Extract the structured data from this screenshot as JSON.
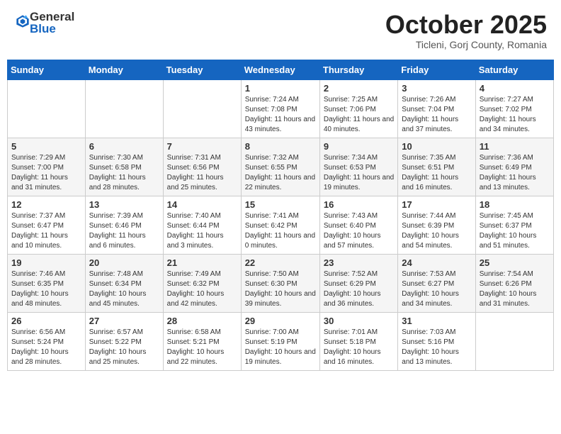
{
  "header": {
    "logo_general": "General",
    "logo_blue": "Blue",
    "month": "October 2025",
    "location": "Ticleni, Gorj County, Romania"
  },
  "days_of_week": [
    "Sunday",
    "Monday",
    "Tuesday",
    "Wednesday",
    "Thursday",
    "Friday",
    "Saturday"
  ],
  "weeks": [
    [
      {
        "num": "",
        "sunrise": "",
        "sunset": "",
        "daylight": ""
      },
      {
        "num": "",
        "sunrise": "",
        "sunset": "",
        "daylight": ""
      },
      {
        "num": "",
        "sunrise": "",
        "sunset": "",
        "daylight": ""
      },
      {
        "num": "1",
        "sunrise": "Sunrise: 7:24 AM",
        "sunset": "Sunset: 7:08 PM",
        "daylight": "Daylight: 11 hours and 43 minutes."
      },
      {
        "num": "2",
        "sunrise": "Sunrise: 7:25 AM",
        "sunset": "Sunset: 7:06 PM",
        "daylight": "Daylight: 11 hours and 40 minutes."
      },
      {
        "num": "3",
        "sunrise": "Sunrise: 7:26 AM",
        "sunset": "Sunset: 7:04 PM",
        "daylight": "Daylight: 11 hours and 37 minutes."
      },
      {
        "num": "4",
        "sunrise": "Sunrise: 7:27 AM",
        "sunset": "Sunset: 7:02 PM",
        "daylight": "Daylight: 11 hours and 34 minutes."
      }
    ],
    [
      {
        "num": "5",
        "sunrise": "Sunrise: 7:29 AM",
        "sunset": "Sunset: 7:00 PM",
        "daylight": "Daylight: 11 hours and 31 minutes."
      },
      {
        "num": "6",
        "sunrise": "Sunrise: 7:30 AM",
        "sunset": "Sunset: 6:58 PM",
        "daylight": "Daylight: 11 hours and 28 minutes."
      },
      {
        "num": "7",
        "sunrise": "Sunrise: 7:31 AM",
        "sunset": "Sunset: 6:56 PM",
        "daylight": "Daylight: 11 hours and 25 minutes."
      },
      {
        "num": "8",
        "sunrise": "Sunrise: 7:32 AM",
        "sunset": "Sunset: 6:55 PM",
        "daylight": "Daylight: 11 hours and 22 minutes."
      },
      {
        "num": "9",
        "sunrise": "Sunrise: 7:34 AM",
        "sunset": "Sunset: 6:53 PM",
        "daylight": "Daylight: 11 hours and 19 minutes."
      },
      {
        "num": "10",
        "sunrise": "Sunrise: 7:35 AM",
        "sunset": "Sunset: 6:51 PM",
        "daylight": "Daylight: 11 hours and 16 minutes."
      },
      {
        "num": "11",
        "sunrise": "Sunrise: 7:36 AM",
        "sunset": "Sunset: 6:49 PM",
        "daylight": "Daylight: 11 hours and 13 minutes."
      }
    ],
    [
      {
        "num": "12",
        "sunrise": "Sunrise: 7:37 AM",
        "sunset": "Sunset: 6:47 PM",
        "daylight": "Daylight: 11 hours and 10 minutes."
      },
      {
        "num": "13",
        "sunrise": "Sunrise: 7:39 AM",
        "sunset": "Sunset: 6:46 PM",
        "daylight": "Daylight: 11 hours and 6 minutes."
      },
      {
        "num": "14",
        "sunrise": "Sunrise: 7:40 AM",
        "sunset": "Sunset: 6:44 PM",
        "daylight": "Daylight: 11 hours and 3 minutes."
      },
      {
        "num": "15",
        "sunrise": "Sunrise: 7:41 AM",
        "sunset": "Sunset: 6:42 PM",
        "daylight": "Daylight: 11 hours and 0 minutes."
      },
      {
        "num": "16",
        "sunrise": "Sunrise: 7:43 AM",
        "sunset": "Sunset: 6:40 PM",
        "daylight": "Daylight: 10 hours and 57 minutes."
      },
      {
        "num": "17",
        "sunrise": "Sunrise: 7:44 AM",
        "sunset": "Sunset: 6:39 PM",
        "daylight": "Daylight: 10 hours and 54 minutes."
      },
      {
        "num": "18",
        "sunrise": "Sunrise: 7:45 AM",
        "sunset": "Sunset: 6:37 PM",
        "daylight": "Daylight: 10 hours and 51 minutes."
      }
    ],
    [
      {
        "num": "19",
        "sunrise": "Sunrise: 7:46 AM",
        "sunset": "Sunset: 6:35 PM",
        "daylight": "Daylight: 10 hours and 48 minutes."
      },
      {
        "num": "20",
        "sunrise": "Sunrise: 7:48 AM",
        "sunset": "Sunset: 6:34 PM",
        "daylight": "Daylight: 10 hours and 45 minutes."
      },
      {
        "num": "21",
        "sunrise": "Sunrise: 7:49 AM",
        "sunset": "Sunset: 6:32 PM",
        "daylight": "Daylight: 10 hours and 42 minutes."
      },
      {
        "num": "22",
        "sunrise": "Sunrise: 7:50 AM",
        "sunset": "Sunset: 6:30 PM",
        "daylight": "Daylight: 10 hours and 39 minutes."
      },
      {
        "num": "23",
        "sunrise": "Sunrise: 7:52 AM",
        "sunset": "Sunset: 6:29 PM",
        "daylight": "Daylight: 10 hours and 36 minutes."
      },
      {
        "num": "24",
        "sunrise": "Sunrise: 7:53 AM",
        "sunset": "Sunset: 6:27 PM",
        "daylight": "Daylight: 10 hours and 34 minutes."
      },
      {
        "num": "25",
        "sunrise": "Sunrise: 7:54 AM",
        "sunset": "Sunset: 6:26 PM",
        "daylight": "Daylight: 10 hours and 31 minutes."
      }
    ],
    [
      {
        "num": "26",
        "sunrise": "Sunrise: 6:56 AM",
        "sunset": "Sunset: 5:24 PM",
        "daylight": "Daylight: 10 hours and 28 minutes."
      },
      {
        "num": "27",
        "sunrise": "Sunrise: 6:57 AM",
        "sunset": "Sunset: 5:22 PM",
        "daylight": "Daylight: 10 hours and 25 minutes."
      },
      {
        "num": "28",
        "sunrise": "Sunrise: 6:58 AM",
        "sunset": "Sunset: 5:21 PM",
        "daylight": "Daylight: 10 hours and 22 minutes."
      },
      {
        "num": "29",
        "sunrise": "Sunrise: 7:00 AM",
        "sunset": "Sunset: 5:19 PM",
        "daylight": "Daylight: 10 hours and 19 minutes."
      },
      {
        "num": "30",
        "sunrise": "Sunrise: 7:01 AM",
        "sunset": "Sunset: 5:18 PM",
        "daylight": "Daylight: 10 hours and 16 minutes."
      },
      {
        "num": "31",
        "sunrise": "Sunrise: 7:03 AM",
        "sunset": "Sunset: 5:16 PM",
        "daylight": "Daylight: 10 hours and 13 minutes."
      },
      {
        "num": "",
        "sunrise": "",
        "sunset": "",
        "daylight": ""
      }
    ]
  ]
}
